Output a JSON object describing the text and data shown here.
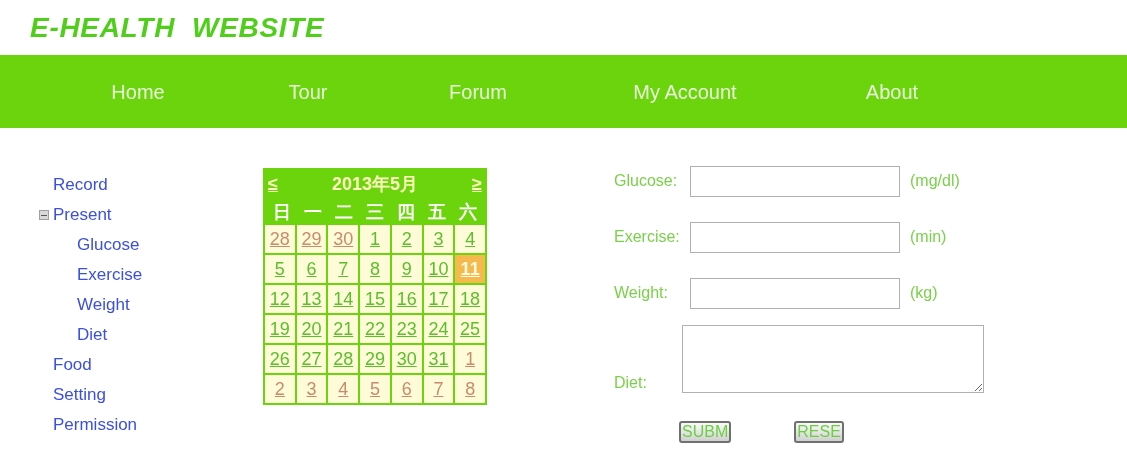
{
  "site_title": "E-HEALTH  WEBSITE",
  "nav": [
    {
      "label": "Home"
    },
    {
      "label": "Tour"
    },
    {
      "label": "Forum"
    },
    {
      "label": "My Account"
    },
    {
      "label": "About"
    }
  ],
  "sidebar": {
    "items": [
      {
        "label": "Record"
      },
      {
        "label": "Present",
        "expanded": true,
        "children": [
          {
            "label": "Glucose"
          },
          {
            "label": "Exercise"
          },
          {
            "label": "Weight"
          },
          {
            "label": "Diet"
          }
        ]
      },
      {
        "label": "Food"
      },
      {
        "label": "Setting"
      },
      {
        "label": "Permission"
      }
    ]
  },
  "calendar": {
    "prev": "≤",
    "title": "2013年5月",
    "next": "≥",
    "weekdays": [
      "日",
      "一",
      "二",
      "三",
      "四",
      "五",
      "六"
    ],
    "weeks": [
      [
        {
          "day": "28",
          "kind": "other",
          "selected": false
        },
        {
          "day": "29",
          "kind": "other",
          "selected": false
        },
        {
          "day": "30",
          "kind": "other",
          "selected": false
        },
        {
          "day": "1",
          "kind": "current",
          "selected": false
        },
        {
          "day": "2",
          "kind": "current",
          "selected": false
        },
        {
          "day": "3",
          "kind": "current",
          "selected": false
        },
        {
          "day": "4",
          "kind": "current",
          "selected": false
        }
      ],
      [
        {
          "day": "5",
          "kind": "current",
          "selected": false
        },
        {
          "day": "6",
          "kind": "current",
          "selected": false
        },
        {
          "day": "7",
          "kind": "current",
          "selected": false
        },
        {
          "day": "8",
          "kind": "current",
          "selected": false
        },
        {
          "day": "9",
          "kind": "current",
          "selected": false
        },
        {
          "day": "10",
          "kind": "current",
          "selected": false
        },
        {
          "day": "11",
          "kind": "current",
          "selected": true
        }
      ],
      [
        {
          "day": "12",
          "kind": "current",
          "selected": false
        },
        {
          "day": "13",
          "kind": "current",
          "selected": false
        },
        {
          "day": "14",
          "kind": "current",
          "selected": false
        },
        {
          "day": "15",
          "kind": "current",
          "selected": false
        },
        {
          "day": "16",
          "kind": "current",
          "selected": false
        },
        {
          "day": "17",
          "kind": "current",
          "selected": false
        },
        {
          "day": "18",
          "kind": "current",
          "selected": false
        }
      ],
      [
        {
          "day": "19",
          "kind": "current",
          "selected": false
        },
        {
          "day": "20",
          "kind": "current",
          "selected": false
        },
        {
          "day": "21",
          "kind": "current",
          "selected": false
        },
        {
          "day": "22",
          "kind": "current",
          "selected": false
        },
        {
          "day": "23",
          "kind": "current",
          "selected": false
        },
        {
          "day": "24",
          "kind": "current",
          "selected": false
        },
        {
          "day": "25",
          "kind": "current",
          "selected": false
        }
      ],
      [
        {
          "day": "26",
          "kind": "current",
          "selected": false
        },
        {
          "day": "27",
          "kind": "current",
          "selected": false
        },
        {
          "day": "28",
          "kind": "current",
          "selected": false
        },
        {
          "day": "29",
          "kind": "current",
          "selected": false
        },
        {
          "day": "30",
          "kind": "current",
          "selected": false
        },
        {
          "day": "31",
          "kind": "current",
          "selected": false
        },
        {
          "day": "1",
          "kind": "other",
          "selected": false
        }
      ],
      [
        {
          "day": "2",
          "kind": "other",
          "selected": false
        },
        {
          "day": "3",
          "kind": "other",
          "selected": false
        },
        {
          "day": "4",
          "kind": "other",
          "selected": false
        },
        {
          "day": "5",
          "kind": "other",
          "selected": false
        },
        {
          "day": "6",
          "kind": "other",
          "selected": false
        },
        {
          "day": "7",
          "kind": "other",
          "selected": false
        },
        {
          "day": "8",
          "kind": "other",
          "selected": false
        }
      ]
    ]
  },
  "form": {
    "fields": [
      {
        "label": "Glucose:",
        "unit": "(mg/dl)",
        "kind": "text"
      },
      {
        "label": "Exercise:",
        "unit": "(min)",
        "kind": "text"
      },
      {
        "label": "Weight:",
        "unit": "(kg)",
        "kind": "text"
      },
      {
        "label": "Diet:",
        "kind": "textarea"
      }
    ],
    "buttons": [
      "SUBM",
      "RESE"
    ]
  }
}
